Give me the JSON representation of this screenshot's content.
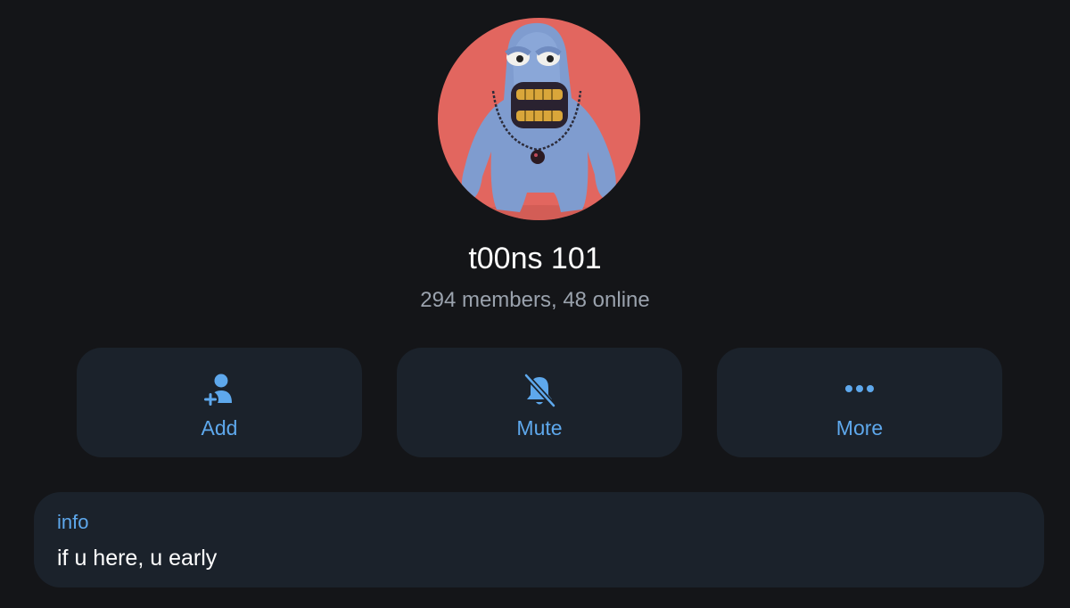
{
  "profile": {
    "name": "t00ns 101",
    "status": "294 members, 48 online"
  },
  "actions": [
    {
      "label": "Add",
      "icon": "add-member-icon"
    },
    {
      "label": "Mute",
      "icon": "bell-slash-icon"
    },
    {
      "label": "More",
      "icon": "more-dots-icon"
    }
  ],
  "info": {
    "label": "info",
    "text": "if u here, u early"
  },
  "colors": {
    "background": "#141518",
    "card": "#1b222b",
    "accent": "#5ea8ec",
    "secondary_text": "#9aa2ad"
  }
}
